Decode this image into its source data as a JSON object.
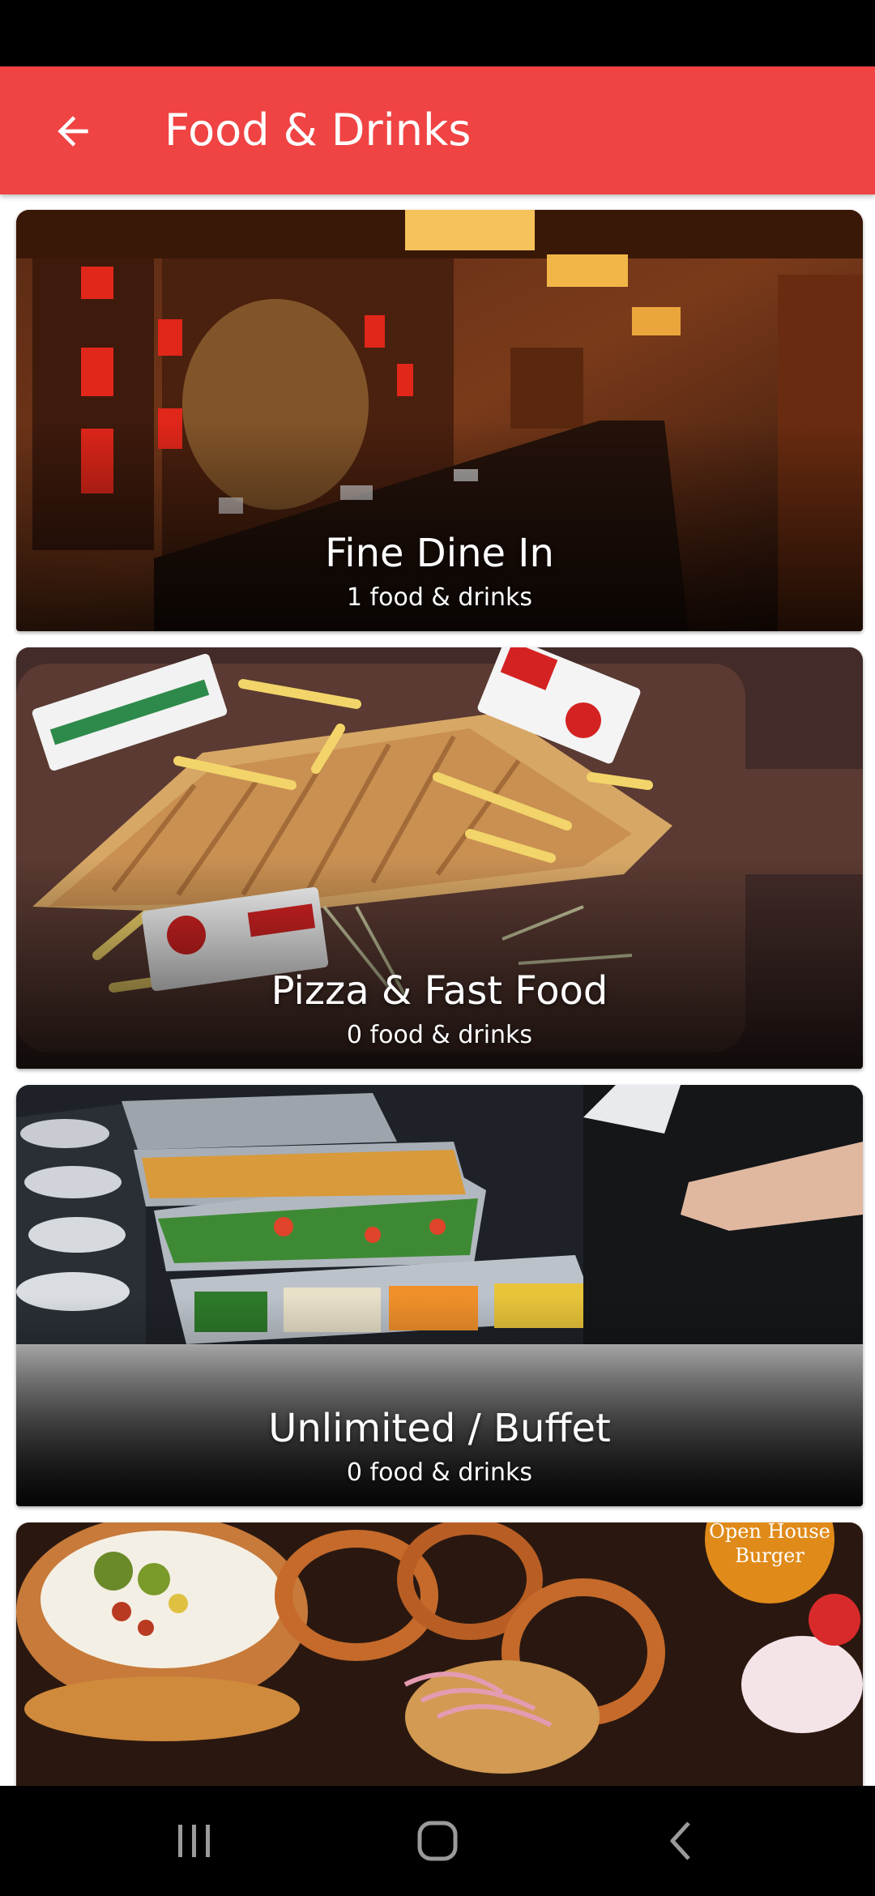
{
  "app_bar": {
    "title": "Food & Drinks",
    "back_icon": "arrow-left-icon",
    "color": "#f04343"
  },
  "categories": [
    {
      "title": "Fine Dine In",
      "count": "1 food & drinks",
      "image": "restaurant-interior-photo"
    },
    {
      "title": "Pizza & Fast Food",
      "count": "0 food & drinks",
      "image": "sandwich-fries-photo"
    },
    {
      "title": "Unlimited / Buffet",
      "count": "0 food & drinks",
      "image": "buffet-trays-photo"
    },
    {
      "title": "",
      "count": "",
      "image": "burger-platter-photo",
      "badge": "Open House Burger"
    }
  ],
  "nav": {
    "recents_icon": "recents-icon",
    "home_icon": "home-icon",
    "back_icon": "back-chevron-icon"
  }
}
